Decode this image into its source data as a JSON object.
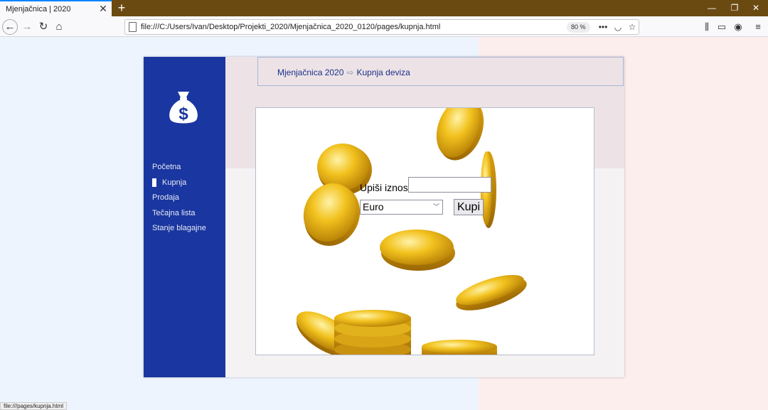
{
  "browser": {
    "tab_title": "Mjenjačnica | 2020",
    "url": "file:///C:/Users/Ivan/Desktop/Projekti_2020/Mjenjačnica_2020_0120/pages/kupnja.html",
    "zoom": "80 %",
    "status_url": "file:///pages/kupnja.html"
  },
  "page": {
    "breadcrumb": {
      "home": "Mjenjačnica 2020",
      "separator": "⇨",
      "current": "Kupnja deviza"
    },
    "menu": [
      {
        "label": "Početna"
      },
      {
        "label": "Kupnja"
      },
      {
        "label": "Prodaja"
      },
      {
        "label": "Tečajna lista"
      },
      {
        "label": "Stanje blagajne"
      }
    ],
    "form": {
      "amount_label": "Upiši iznos",
      "amount_value": "",
      "currency_selected": "Euro",
      "buy_button": "Kupi"
    }
  },
  "colors": {
    "sidebar": "#1a36a0",
    "accent_text": "#1a2f8a",
    "gold": "#e8b417"
  }
}
